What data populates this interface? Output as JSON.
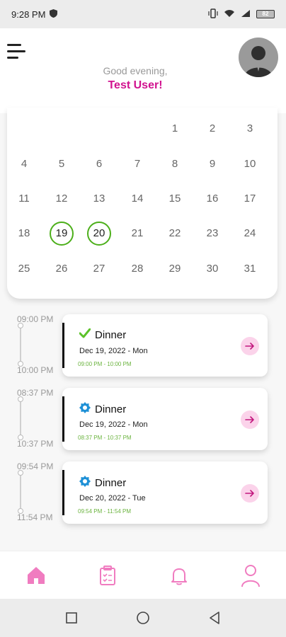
{
  "status_bar": {
    "time": "9:28 PM",
    "battery": "82"
  },
  "header": {
    "greeting": "Good evening,",
    "user_name": "Test User!"
  },
  "calendar": {
    "days": [
      {
        "label": "1",
        "selected": false
      },
      {
        "label": "2",
        "selected": false
      },
      {
        "label": "3",
        "selected": false
      },
      {
        "label": "4",
        "selected": false
      },
      {
        "label": "5",
        "selected": false
      },
      {
        "label": "6",
        "selected": false
      },
      {
        "label": "7",
        "selected": false
      },
      {
        "label": "8",
        "selected": false
      },
      {
        "label": "9",
        "selected": false
      },
      {
        "label": "10",
        "selected": false
      },
      {
        "label": "11",
        "selected": false
      },
      {
        "label": "12",
        "selected": false
      },
      {
        "label": "13",
        "selected": false
      },
      {
        "label": "14",
        "selected": false
      },
      {
        "label": "15",
        "selected": false
      },
      {
        "label": "16",
        "selected": false
      },
      {
        "label": "17",
        "selected": false
      },
      {
        "label": "18",
        "selected": false
      },
      {
        "label": "19",
        "selected": true
      },
      {
        "label": "20",
        "selected": true
      },
      {
        "label": "21",
        "selected": false
      },
      {
        "label": "22",
        "selected": false
      },
      {
        "label": "23",
        "selected": false
      },
      {
        "label": "24",
        "selected": false
      },
      {
        "label": "25",
        "selected": false
      },
      {
        "label": "26",
        "selected": false
      },
      {
        "label": "27",
        "selected": false
      },
      {
        "label": "28",
        "selected": false
      },
      {
        "label": "29",
        "selected": false
      },
      {
        "label": "30",
        "selected": false
      },
      {
        "label": "31",
        "selected": false
      }
    ],
    "selected_color": "#4caf1a"
  },
  "events": [
    {
      "start_time": "09:00 PM",
      "end_time": "10:00 PM",
      "status_icon": "check-icon",
      "title": "Dinner",
      "date": "Dec 19, 2022 - Mon",
      "time_range": "09:00 PM  -  10:00 PM"
    },
    {
      "start_time": "08:37 PM",
      "end_time": "10:37 PM",
      "status_icon": "pending-badge-icon",
      "title": "Dinner",
      "date": "Dec 19, 2022 - Mon",
      "time_range": "08:37 PM  -  10:37 PM"
    },
    {
      "start_time": "09:54 PM",
      "end_time": "11:54 PM",
      "status_icon": "pending-badge-icon",
      "title": "Dinner",
      "date": "Dec 20, 2022 - Tue",
      "time_range": "09:54 PM  -  11:54 PM"
    }
  ],
  "bottom_nav": [
    {
      "icon": "home-icon"
    },
    {
      "icon": "clipboard-icon"
    },
    {
      "icon": "bell-icon"
    },
    {
      "icon": "profile-icon"
    }
  ],
  "colors": {
    "accent_pink": "#d1128f",
    "nav_pink": "#f07cc0",
    "time_green": "#6ab33e",
    "check_green": "#5cc22a",
    "badge_blue": "#1e90d6"
  }
}
